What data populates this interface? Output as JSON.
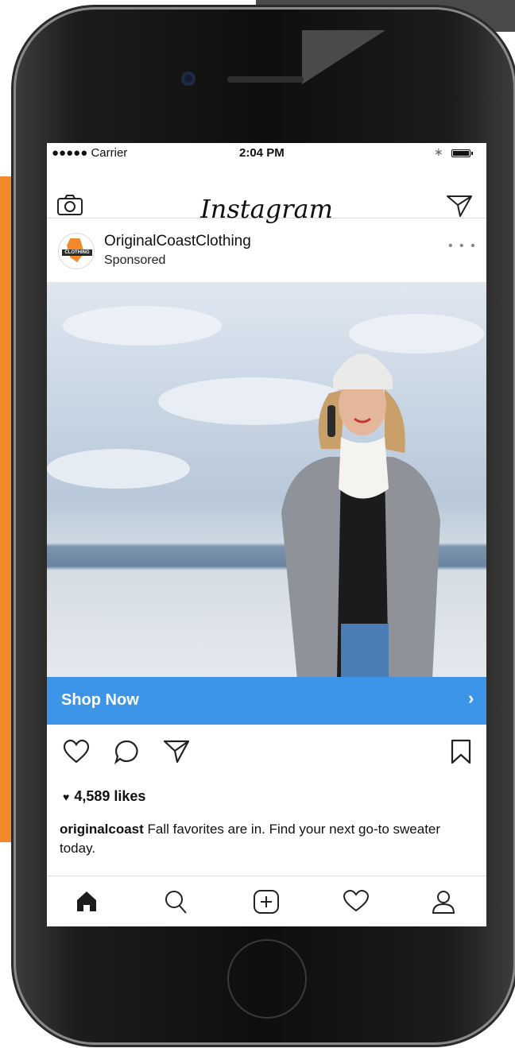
{
  "status_bar": {
    "carrier": "●●●●● Carrier",
    "time": "2:04 PM",
    "bluetooth": "∗"
  },
  "header": {
    "app_title": "Instagram",
    "icons": [
      "camera-icon",
      "direct-message-icon"
    ]
  },
  "post": {
    "account_name": "OriginalCoastClothing",
    "sponsored_label": "Sponsored",
    "avatar_text": "CLOTHING",
    "more_icon": "more-options-icon",
    "cta_label": "Shop Now",
    "cta_chevron": "›",
    "likes_count": "4,589 likes",
    "caption_user": "originalcoast",
    "caption_text": " Fall favorites are in. Find your next go-to sweater today.",
    "action_icons": [
      "heart-icon",
      "comment-icon",
      "share-icon",
      "bookmark-icon"
    ]
  },
  "tab_bar": {
    "icons": [
      "home-icon",
      "search-icon",
      "add-post-icon",
      "activity-heart-icon",
      "profile-icon"
    ]
  },
  "colors": {
    "accent_orange": "#f28a2c",
    "cta_blue": "#3c95e8",
    "phone_body": "#111111"
  }
}
